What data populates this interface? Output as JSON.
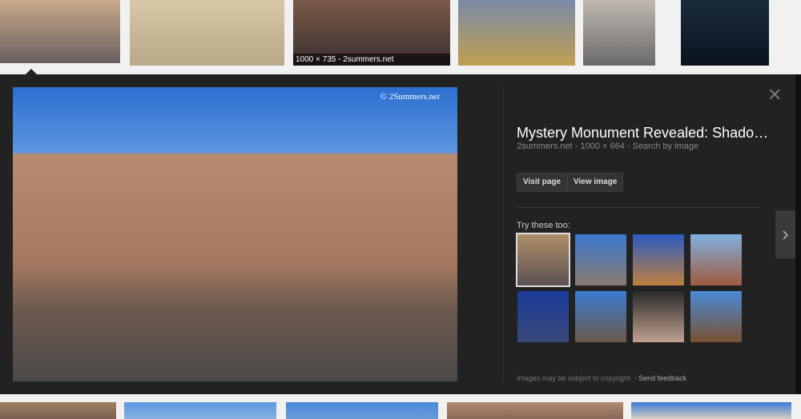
{
  "top_thumbnails": [
    {
      "bg": "linear-gradient(#c9a98a,#6a6060)"
    },
    {
      "bg": "linear-gradient(#d8c8a8,#b8a888)"
    },
    {
      "bg": "linear-gradient(#7a5a48,#3a3030)",
      "caption": "1000 × 735 - 2summers.net"
    },
    {
      "bg": "linear-gradient(#7a8aa8,#c0a050)"
    },
    {
      "bg": "linear-gradient(#c0b8b0,#6a6a6a)"
    },
    {
      "bg": "linear-gradient(#1a2a3a,#0a1420)"
    }
  ],
  "preview": {
    "watermark": "© 2Summers.net",
    "title": "Mystery Monument Revealed: Shado…",
    "subtitle": "2summers.net - 1000 × 664 - Search by image",
    "visit_page": "Visit page",
    "view_image": "View image",
    "try_label": "Try these too:",
    "related": [
      {
        "bg": "linear-gradient(#b0906a,#5a5050)"
      },
      {
        "bg": "linear-gradient(#3a78d0,#8a7a70)"
      },
      {
        "bg": "linear-gradient(#2a5ac0,#c08040)"
      },
      {
        "bg": "linear-gradient(#80b0e0,#a05a40)"
      },
      {
        "bg": "linear-gradient(#1a3a9a,#3a4a7a)"
      },
      {
        "bg": "linear-gradient(#3a7ad0,#6a5a4a)"
      },
      {
        "bg": "linear-gradient(#2a2a2a,#c0a090)"
      },
      {
        "bg": "linear-gradient(#4a8ad8,#7a5030)"
      }
    ],
    "copyright": "Images may be subject to copyright.",
    "separator": " - ",
    "feedback": "Send feedback"
  },
  "bottom_thumbnails": [
    {
      "bg": "linear-gradient(#a08060,#7a6050)"
    },
    {
      "bg": "linear-gradient(#5a9ae0,#8ab0e0)"
    },
    {
      "bg": "linear-gradient(#4a8ad8,#6a9ad8)"
    },
    {
      "bg": "linear-gradient(#b08a70,#8a6a58)"
    },
    {
      "bg": "linear-gradient(#3a7ad8,#d8d0c0)"
    }
  ]
}
